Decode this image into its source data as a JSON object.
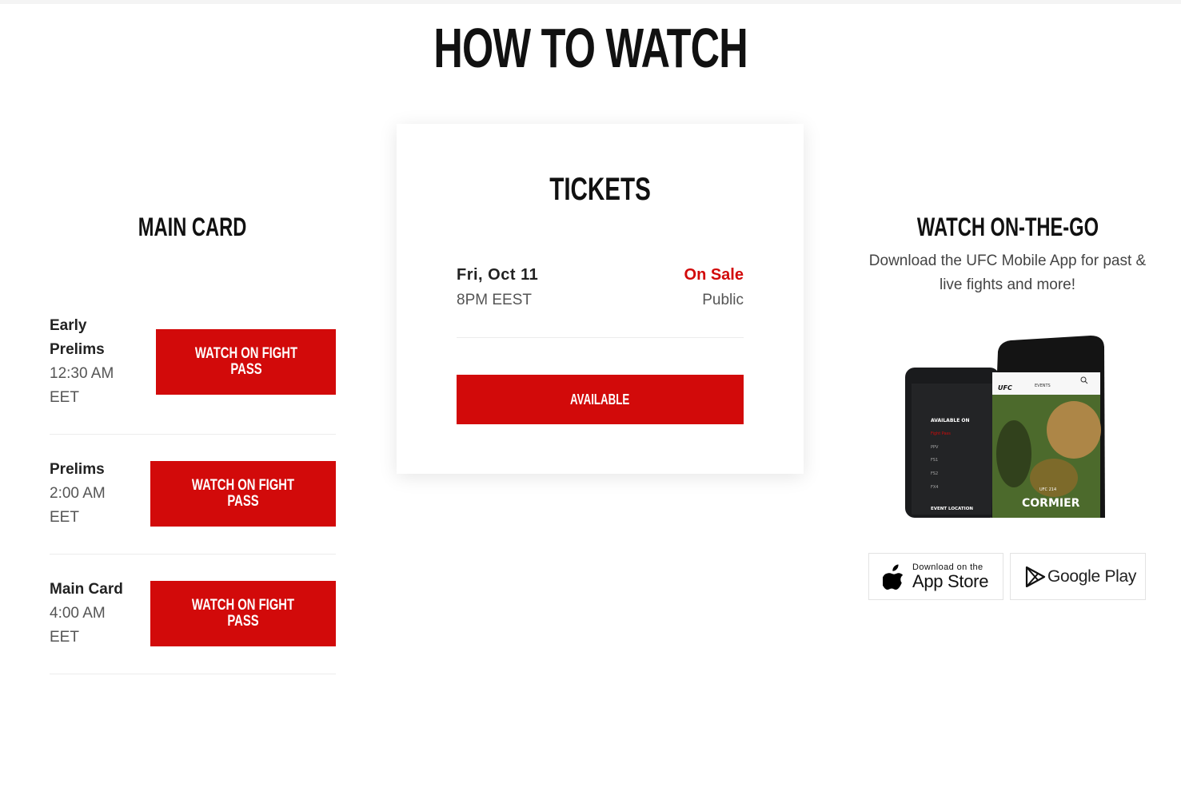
{
  "page": {
    "title": "HOW TO WATCH"
  },
  "main_card": {
    "heading": "MAIN CARD",
    "bouts": [
      {
        "name_line1": "Early",
        "name_line2": "Prelims",
        "time": "12:30 AM",
        "timezone": "EET",
        "button_label": "WATCH ON FIGHT PASS"
      },
      {
        "name_line1": "Prelims",
        "time": "2:00 AM",
        "timezone": "EET",
        "button_label": "WATCH ON FIGHT PASS"
      },
      {
        "name_line1": "Main Card",
        "time": "4:00 AM",
        "timezone": "EET",
        "button_label": "WATCH ON FIGHT PASS"
      }
    ]
  },
  "tickets": {
    "heading": "TICKETS",
    "date": "Fri, Oct 11",
    "time": "8PM EEST",
    "status": "On Sale",
    "type": "Public",
    "button_label": "AVAILABLE"
  },
  "on_the_go": {
    "heading": "WATCH ON-THE-GO",
    "description_line1": "Download the UFC Mobile App for past &",
    "description_line2": "live fights and more!",
    "phone_mock": {
      "brand": "UFC",
      "events_label": "EVENTS",
      "menu_heading": "AVAILABLE ON",
      "menu_items": [
        "Fight Pass",
        "PPV",
        "FS1",
        "FS2",
        "FX4"
      ],
      "menu_footer": "EVENT LOCATION",
      "poster_event": "UFC 214",
      "poster_name": "CORMIER"
    },
    "app_store": {
      "small": "Download on the",
      "big": "App Store"
    },
    "google_play": {
      "label": "Google Play"
    }
  },
  "colors": {
    "accent": "#d20a0a",
    "text": "#111111",
    "muted": "#555555"
  },
  "icons": [
    "apple-icon",
    "google-play-icon",
    "search-icon"
  ]
}
